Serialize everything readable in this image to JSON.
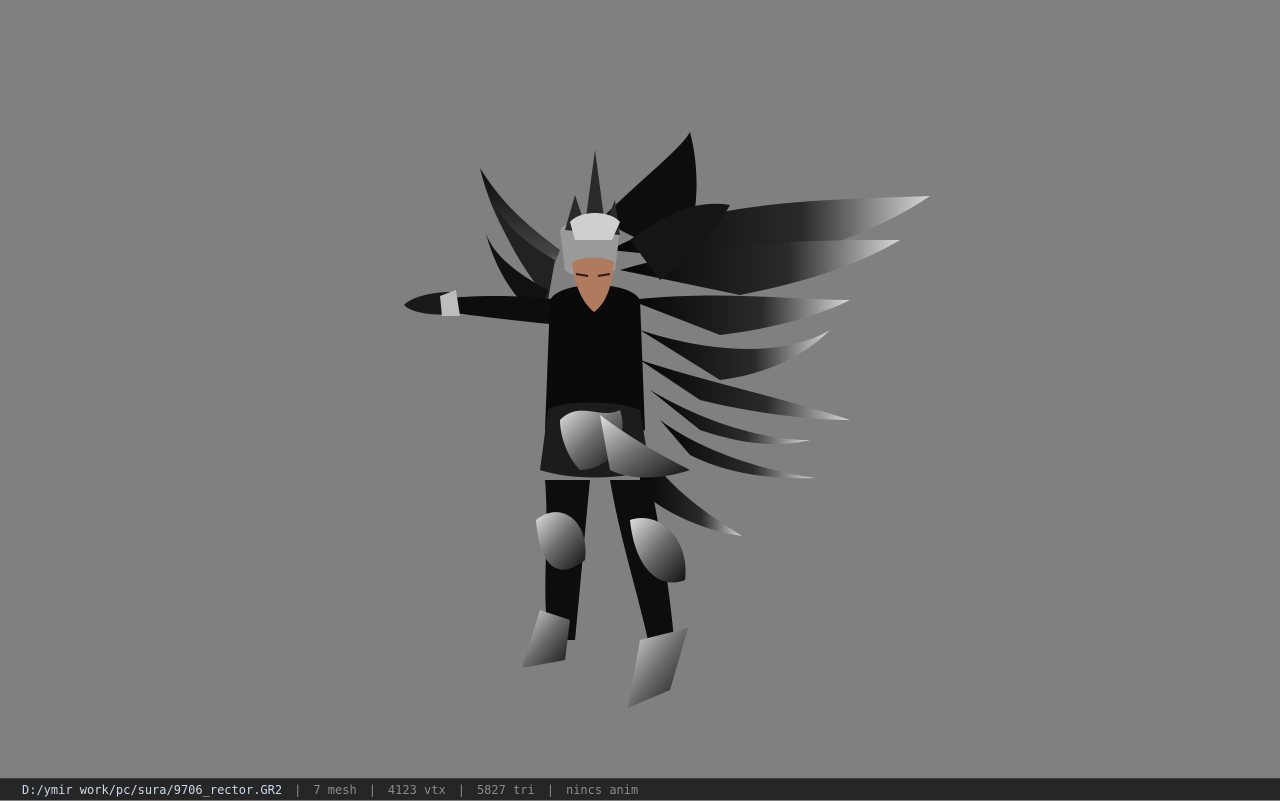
{
  "viewer": {
    "background_color": "#808080",
    "model_subject": "dark winged armored character"
  },
  "statusbar": {
    "file_path": "D:/ymir work/pc/sura/9706_rector.GR2",
    "separator": "|",
    "mesh_count": "7 mesh",
    "vertex_count": "4123 vtx",
    "triangle_count": "5827 tri",
    "anim": "nincs anim"
  }
}
